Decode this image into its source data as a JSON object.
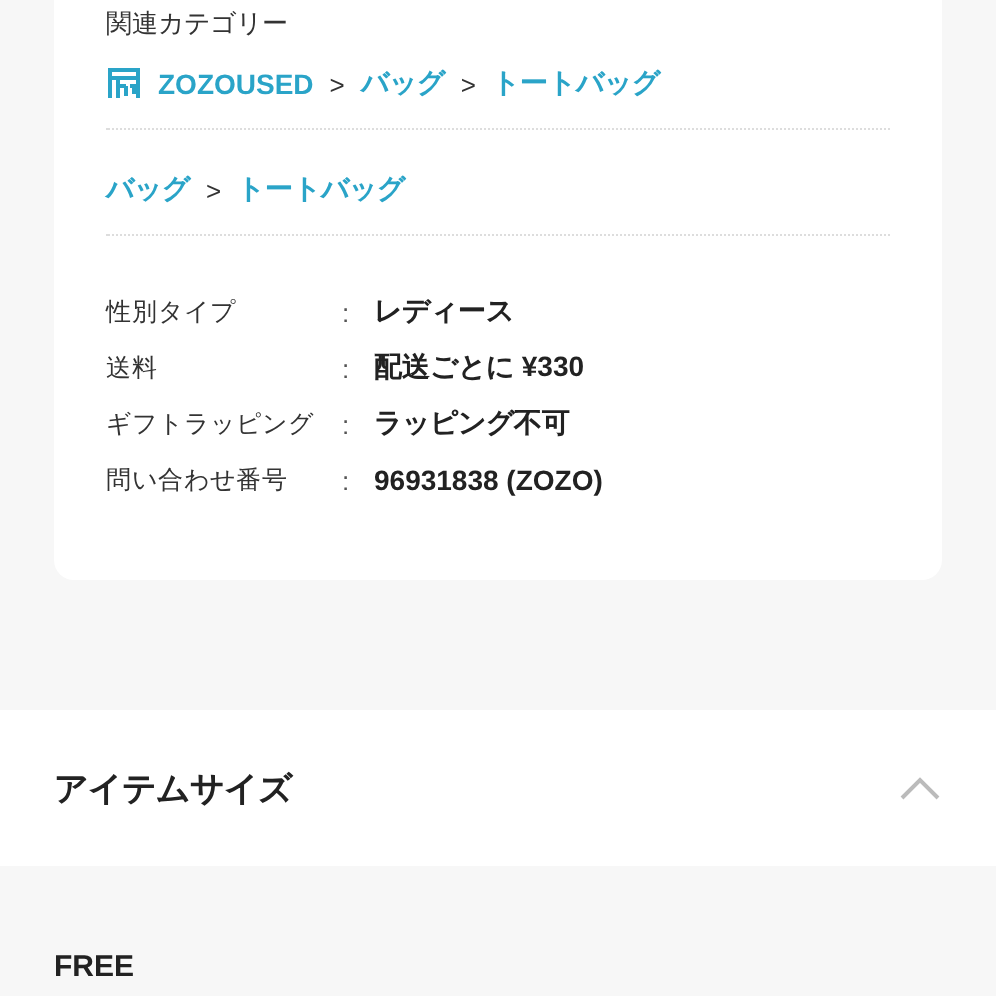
{
  "related_categories": {
    "label": "関連カテゴリー",
    "separator": ">",
    "trails": [
      {
        "items": [
          {
            "text": "ZOZOUSED",
            "kind": "shop"
          },
          {
            "text": "バッグ",
            "kind": "link"
          },
          {
            "text": "トートバッグ",
            "kind": "link"
          }
        ]
      },
      {
        "items": [
          {
            "text": "バッグ",
            "kind": "link"
          },
          {
            "text": "トートバッグ",
            "kind": "link"
          }
        ]
      }
    ]
  },
  "details": {
    "colon": ":",
    "rows": [
      {
        "label": "性別タイプ",
        "value": "レディース"
      },
      {
        "label": "送料",
        "value": "配送ごとに ¥330"
      },
      {
        "label": "ギフトラッピング",
        "value": "ラッピング不可"
      },
      {
        "label": "問い合わせ番号",
        "value": "96931838 (ZOZO)"
      }
    ]
  },
  "item_size": {
    "title": "アイテムサイズ",
    "expanded": true,
    "sizes": [
      "FREE"
    ]
  }
}
